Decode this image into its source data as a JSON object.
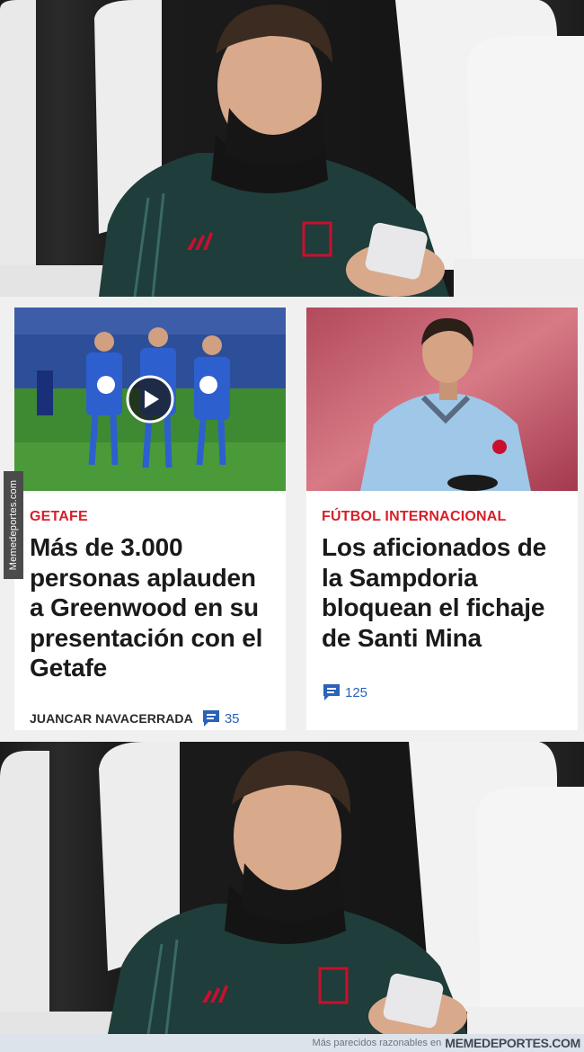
{
  "articles": [
    {
      "category": "GETAFE",
      "headline": "Más de 3.000 personas aplauden a Greenwood en su presentación con el Getafe",
      "author": "JUANCAR NAVACERRADA",
      "comments": "35",
      "image_caption_icon": "play-icon"
    },
    {
      "category": "FÚTBOL INTERNACIONAL",
      "headline": "Los aficionados de la Sampdoria bloquean el fichaje de Santi Mina",
      "comments": "125"
    }
  ],
  "watermark": {
    "side": "Memedeportes.com"
  },
  "footer": {
    "text": "Más parecidos razonables en",
    "brand": "MEMEDEPORTES.COM"
  },
  "colors": {
    "category_red": "#d6202a",
    "comment_blue": "#2a63b7",
    "jersey_green": "#1f3d3a"
  }
}
